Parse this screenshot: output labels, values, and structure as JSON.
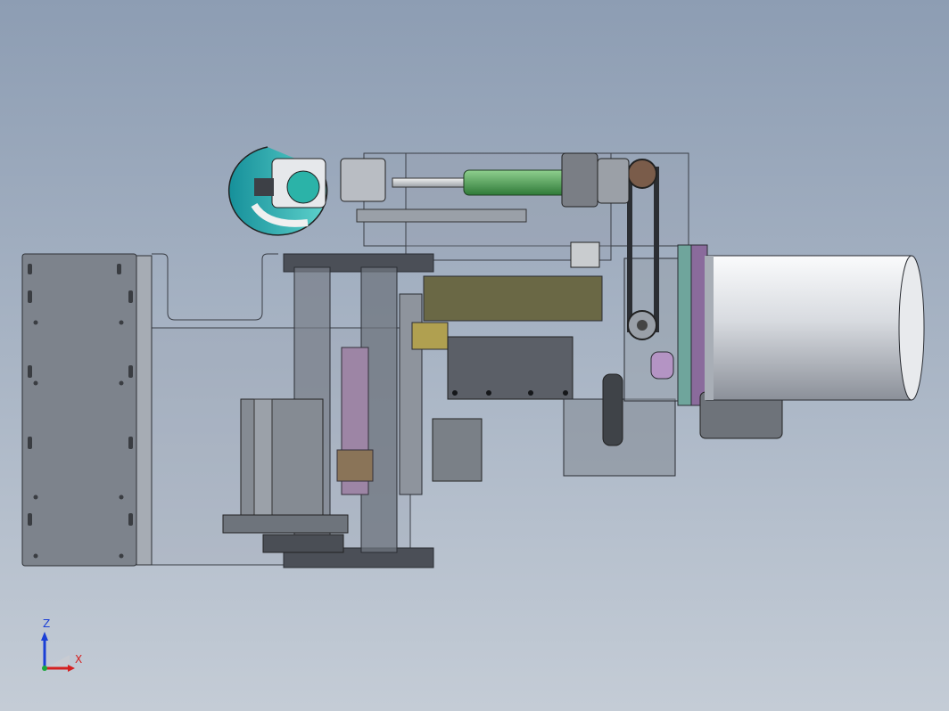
{
  "viewport": {
    "background_top": "#8d9db3",
    "background_bottom": "#c4ccd6"
  },
  "triad": {
    "z_label": "Z",
    "x_label": "X",
    "z_color": "#1a3fd6",
    "x_color": "#d42020",
    "origin_color": "#1aa83a"
  },
  "model": {
    "body_color": "#8c939d",
    "dark_color": "#3d4046",
    "motor_color": "#e9ebee",
    "accent_green": "#3f9a4a",
    "accent_teal": "#2aa6a6",
    "accent_purple": "#8a5fa3"
  }
}
